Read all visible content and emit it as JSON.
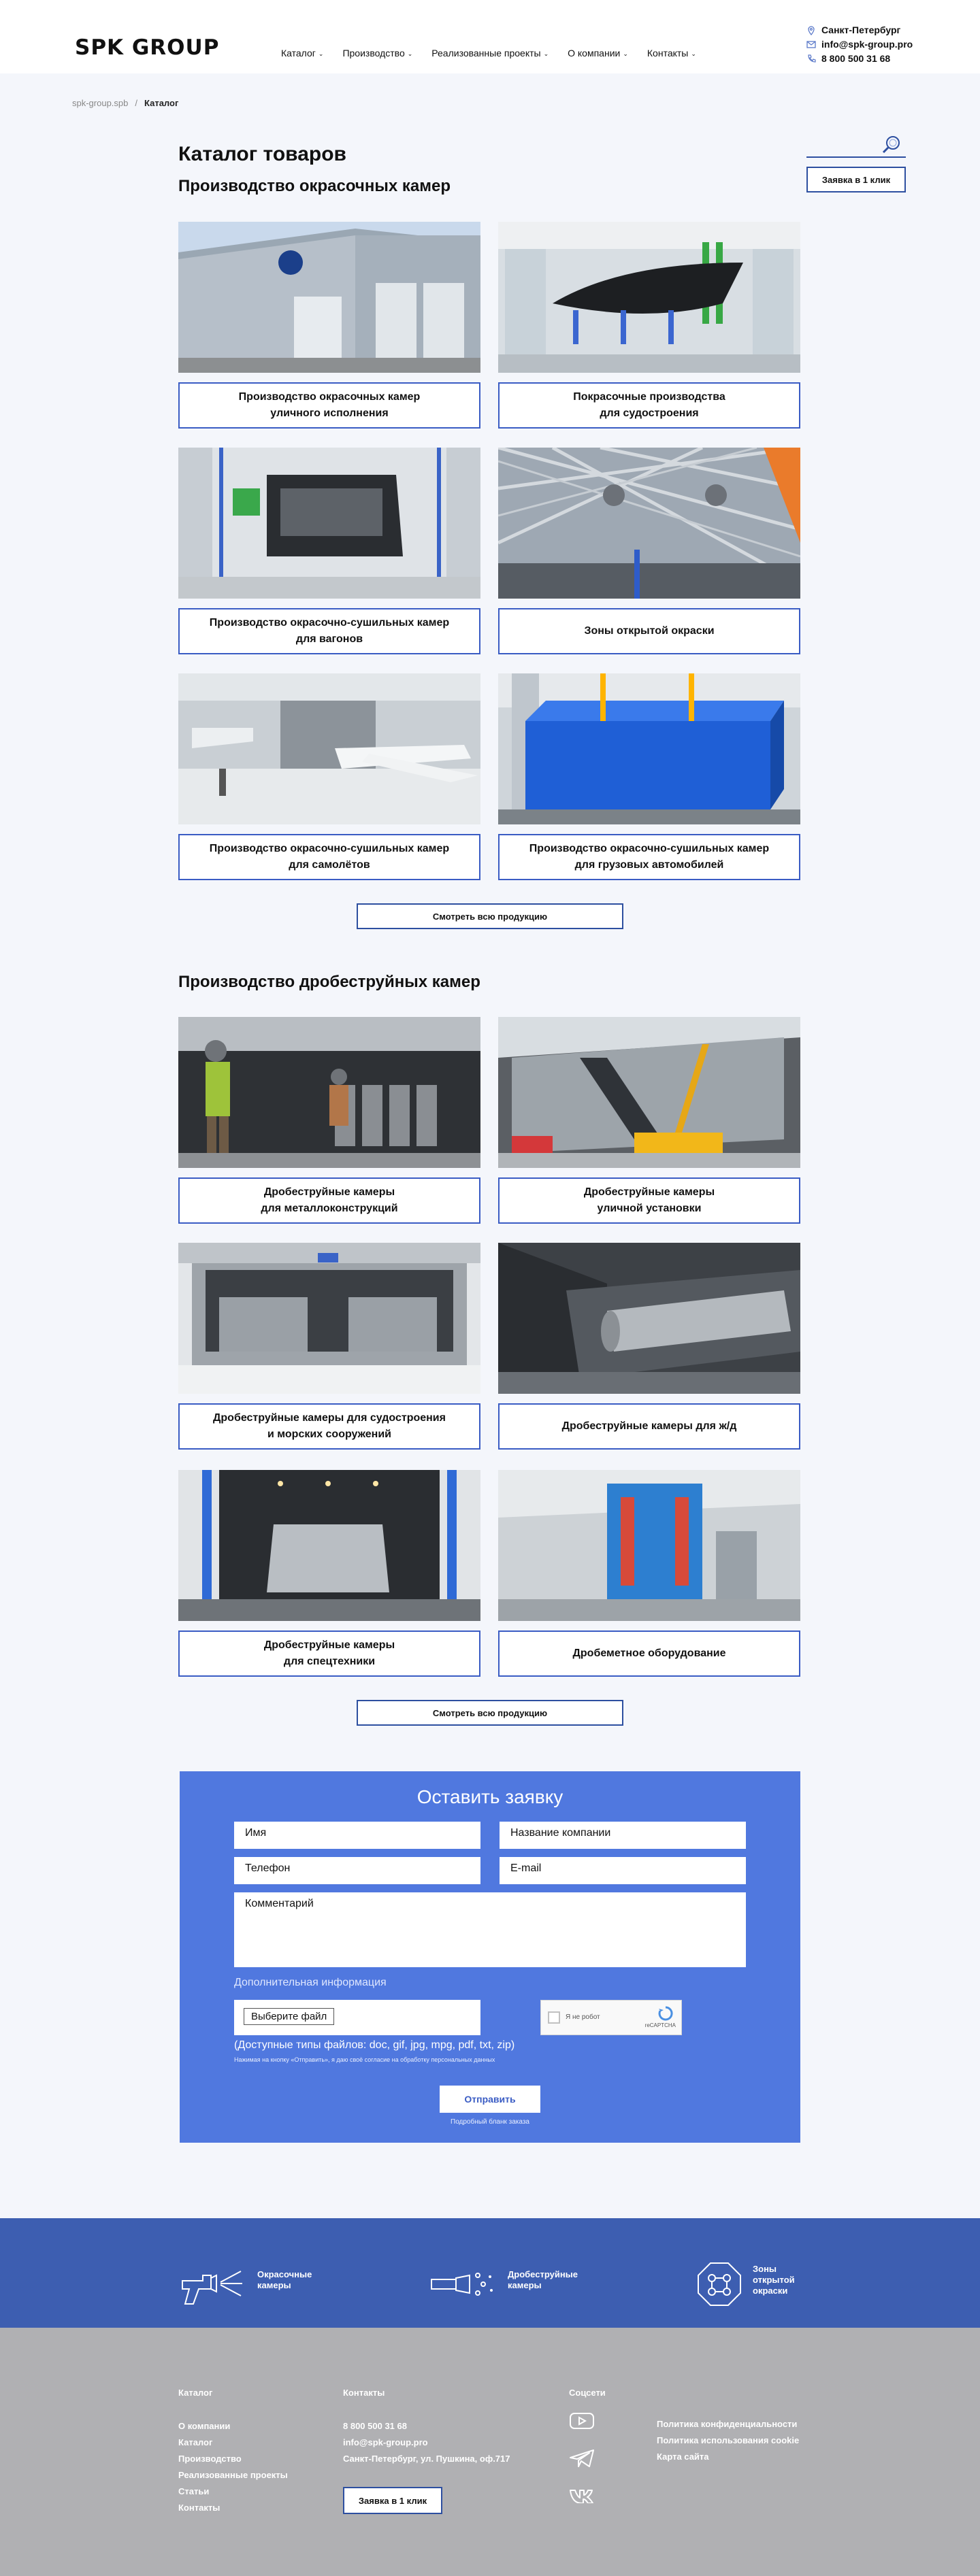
{
  "header": {
    "logo": "SPK GROUP",
    "nav": [
      {
        "label": "Каталог"
      },
      {
        "label": "Производство"
      },
      {
        "label": "Реализованные проекты"
      },
      {
        "label": "О компании"
      },
      {
        "label": "Контакты"
      }
    ],
    "city": "Санкт-Петербург",
    "email": "info@spk-group.pro",
    "phone": "8 800 500 31 68"
  },
  "breadcrumb": {
    "home": "spk-group.spb",
    "separator": "/",
    "current": "Каталог"
  },
  "page_title": "Каталог товаров",
  "request_button": "Заявка в 1 клик",
  "section1": {
    "title": "Производство окрасочных камер",
    "cards": [
      {
        "caption": "Производство окрасочных камер\nуличного исполнения"
      },
      {
        "caption": "Покрасочные производства\nдля судостроения"
      },
      {
        "caption": "Производство окрасочно-сушильных камер\nдля вагонов"
      },
      {
        "caption": "Зоны открытой окраски"
      },
      {
        "caption": "Производство окрасочно-сушильных камер\nдля самолётов"
      },
      {
        "caption": "Производство окрасочно-сушильных камер\nдля грузовых автомобилей"
      }
    ],
    "more": "Смотреть всю продукцию"
  },
  "section2": {
    "title": "Производство дробеструйных камер",
    "cards": [
      {
        "caption": "Дробеструйные камеры\nдля металлоконструкций"
      },
      {
        "caption": "Дробеструйные камеры\nуличной установки"
      },
      {
        "caption": "Дробеструйные камеры для судостроения\nи морских сооружений"
      },
      {
        "caption": "Дробеструйные камеры для ж/д"
      },
      {
        "caption": "Дробеструйные камеры\nдля спецтехники"
      },
      {
        "caption": "Дробеметное оборудование"
      }
    ],
    "more": "Смотреть всю продукцию"
  },
  "form": {
    "title": "Оставить заявку",
    "name": "Имя",
    "company": "Название компании",
    "phone": "Телефон",
    "email": "E-mail",
    "comment": "Комментарий",
    "extra_info": "Дополнительная информация",
    "file_button": "Выберите файл",
    "captcha_label": "Я не робот",
    "captcha_brand": "reCAPTCHA",
    "file_types": "(Доступные типы файлов: doc, gif, jpg, mpg, pdf, txt, zip)",
    "consent": "Нажимая на кнопку «Отправить», я даю своё согласие на обработку персональных данных",
    "submit": "Отправить",
    "link": "Подробный бланк заказа"
  },
  "band": [
    {
      "label": "Окрасочные\nкамеры",
      "icon": "spray-gun-icon"
    },
    {
      "label": "Дробеструйные\nкамеры",
      "icon": "blast-nozzle-icon"
    },
    {
      "label": "Зоны\nоткрытой\nокраски",
      "icon": "open-zone-icon"
    }
  ],
  "footer": {
    "catalog_head": "Каталог",
    "catalog_links": [
      "О компании",
      "Каталог",
      "Производство",
      "Реализованные проекты",
      "Статьи",
      "Контакты"
    ],
    "contacts_head": "Контакты",
    "phone": "8 800 500 31 68",
    "email": "info@spk-group.pro",
    "address": "Санкт-Петербург, ул. Пушкина, оф.717",
    "request": "Заявка в 1 клик",
    "social_head": "Соцсети",
    "policy": [
      "Политика конфиденциальности",
      "Политика использования cookie",
      "Карта сайта"
    ]
  },
  "colors": {
    "accent": "#3a5cc4",
    "form_bg": "#5078df",
    "band_bg": "#3d5eb1",
    "footer_bg": "#b0b0b3"
  }
}
